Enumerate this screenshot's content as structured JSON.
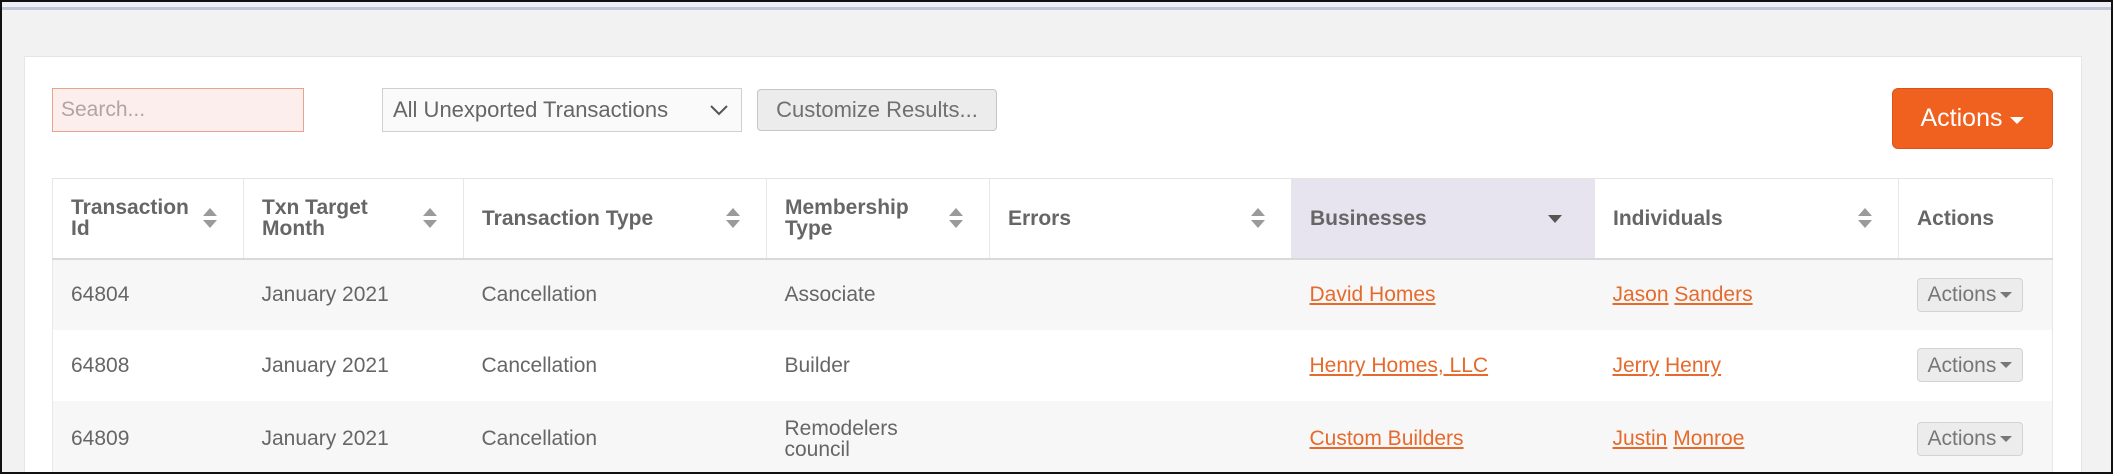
{
  "toolbar": {
    "search_placeholder": "Search...",
    "filter_selected": "All Unexported Transactions",
    "customize_label": "Customize Results...",
    "actions_label": "Actions"
  },
  "table": {
    "headers": [
      "Transaction Id",
      "Txn Target Month",
      "Transaction Type",
      "Membership Type",
      "Errors",
      "Businesses",
      "Individuals",
      "Actions"
    ],
    "sorted_column": "Businesses",
    "rows": [
      {
        "id": "64804",
        "month": "January 2021",
        "type": "Cancellation",
        "membership": "Associate",
        "errors": "",
        "business": "David Homes",
        "individual_first": "Jason",
        "individual_last": "Sanders",
        "action": "Actions"
      },
      {
        "id": "64808",
        "month": "January 2021",
        "type": "Cancellation",
        "membership": "Builder",
        "errors": "",
        "business": "Henry Homes, LLC",
        "individual_first": "Jerry",
        "individual_last": "Henry",
        "action": "Actions"
      },
      {
        "id": "64809",
        "month": "January 2021",
        "type": "Cancellation",
        "membership": "Remodelers council",
        "errors": "",
        "business": "Custom Builders",
        "individual_first": "Justin",
        "individual_last": "Monroe",
        "action": "Actions"
      }
    ]
  },
  "colors": {
    "accent": "#f0611f",
    "link": "#e66a2c",
    "sorted_header_bg": "#e8e4ef"
  }
}
